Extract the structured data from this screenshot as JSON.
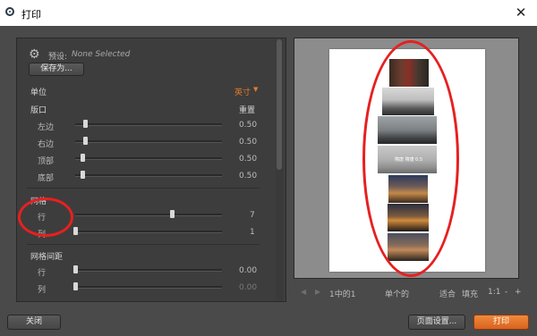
{
  "window": {
    "title": "打印",
    "close_glyph": "✕"
  },
  "settings": {
    "preset_label": "预设:",
    "preset_value": "None Selected",
    "save_as_label": "保存为...",
    "units_label": "单位",
    "units_value": "英寸",
    "margins": {
      "section_label": "版口",
      "reset_label": "重置",
      "rows": [
        {
          "label": "左边",
          "value": "0.50",
          "position": 0.07
        },
        {
          "label": "右边",
          "value": "0.50",
          "position": 0.07
        },
        {
          "label": "顶部",
          "value": "0.50",
          "position": 0.05
        },
        {
          "label": "底部",
          "value": "0.50",
          "position": 0.05
        }
      ]
    },
    "grid": {
      "section_label": "网格",
      "rows": [
        {
          "label": "行",
          "value": "7",
          "position": 0.66
        },
        {
          "label": "列",
          "value": "1",
          "position": 0.0
        }
      ]
    },
    "spacing": {
      "section_label": "网格间距",
      "rows": [
        {
          "label": "行",
          "value": "0.00",
          "position": 0.0
        },
        {
          "label": "列",
          "value": "0.00",
          "position": 0.0
        }
      ]
    }
  },
  "preview": {
    "page_info": "1中的1",
    "mode": "单个的",
    "fit_label": "适合",
    "fill_label": "填充",
    "zoom_label": "1:1",
    "zoom_out": "-",
    "zoom_in": "+",
    "photo_caption": "隋唐 隋唐 0.5"
  },
  "footer": {
    "close_label": "关闭",
    "page_setup_label": "页面设置...",
    "print_label": "打印"
  },
  "colors": {
    "accent": "#e87a2c",
    "panel": "#3d3d3d",
    "frame": "#4a4a4a",
    "annotation": "#e62020"
  }
}
